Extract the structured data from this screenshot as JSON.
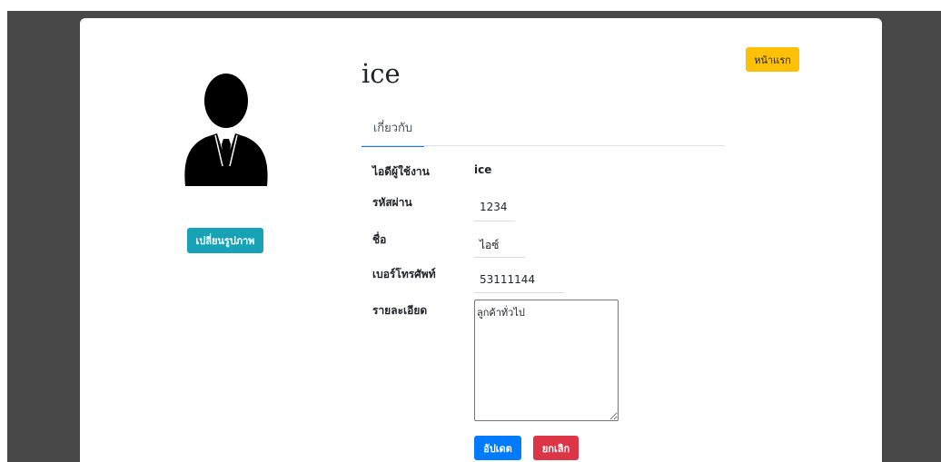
{
  "profile": {
    "name": "ice",
    "change_photo_label": "เปลี่ยนรูปภาพ",
    "home_label": "หน้าแรก"
  },
  "tabs": [
    {
      "label": "เกี่ยวกับ",
      "active": true
    }
  ],
  "fields": {
    "username": {
      "label": "ไอดีผู้ใช้งาน",
      "value": "ice"
    },
    "password": {
      "label": "รหัสผ่าน",
      "value": "1234"
    },
    "name": {
      "label": "ชื่อ",
      "value": "ไอซ์"
    },
    "phone": {
      "label": "เบอร์โทรศัพท์",
      "value": "53111144"
    },
    "details": {
      "label": "รายละเอียด",
      "value": "ลูกค้าทั่วไป"
    }
  },
  "actions": {
    "update_label": "อัปเดต",
    "cancel_label": "ยกเลิก"
  },
  "colors": {
    "backdrop": "#484848",
    "info": "#17a2b8",
    "warning": "#ffc107",
    "primary": "#007bff",
    "danger": "#dc3545",
    "tab_indicator": "#1d75e0"
  },
  "icons": {
    "avatar": "user-in-suit-icon"
  }
}
